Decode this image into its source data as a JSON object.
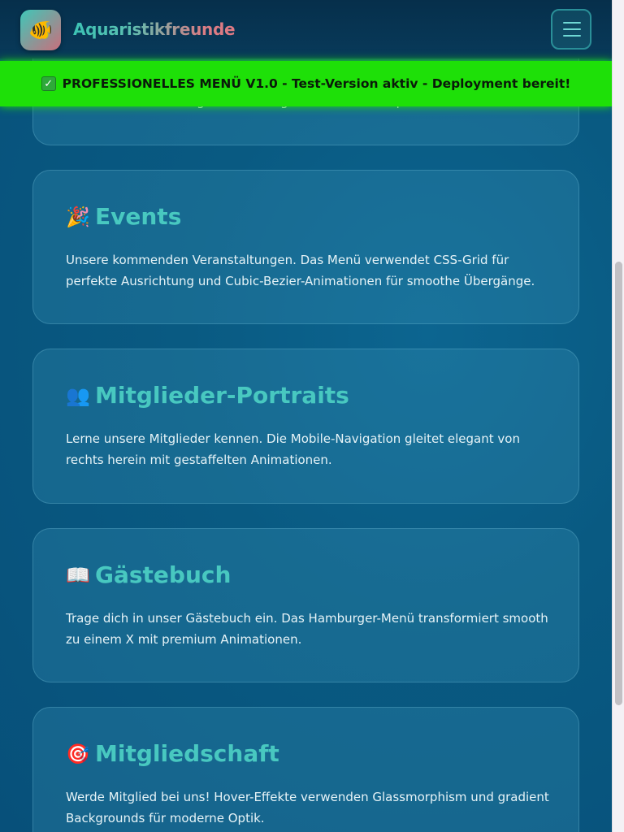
{
  "header": {
    "brand": "Aquaristikfreunde",
    "logo_icon": "fish-icon",
    "menu_icon": "hamburger-menu-icon"
  },
  "banner": {
    "icon": "check-icon",
    "text": "PROFESSIONELLES MENÜ V1.0 - Test-Version aktiv - Deployment bereit!"
  },
  "partial_card": {
    "text": "Hover-Effekt und das gesamte Design ist modern und professionell."
  },
  "cards": [
    {
      "icon": "party-popper-icon",
      "title": "Events",
      "text": "Unsere kommenden Veranstaltungen. Das Menü verwendet CSS-Grid für perfekte Ausrichtung und Cubic-Bezier-Animationen für smoothe Übergänge."
    },
    {
      "icon": "people-icon",
      "title": "Mitglieder-Portraits",
      "text": "Lerne unsere Mitglieder kennen. Die Mobile-Navigation gleitet elegant von rechts herein mit gestaffelten Animationen."
    },
    {
      "icon": "open-book-icon",
      "title": "Gästebuch",
      "text": "Trage dich in unser Gästebuch ein. Das Hamburger-Menü transformiert smooth zu einem X mit premium Animationen."
    },
    {
      "icon": "target-icon",
      "title": "Mitgliedschaft",
      "text": "Werde Mitglied bei uns! Hover-Effekte verwenden Glassmorphism und gradient Backgrounds für moderne Optik."
    }
  ],
  "colors": {
    "accent": "#48c8c0",
    "banner": "#1ee008",
    "header": "#062f4b"
  }
}
